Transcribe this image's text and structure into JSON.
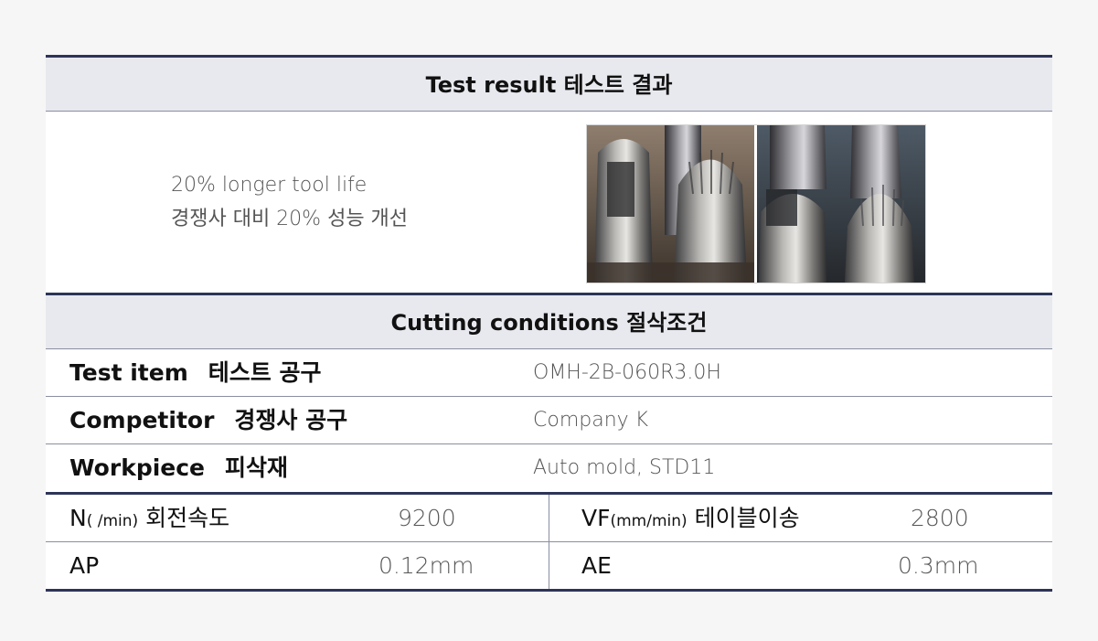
{
  "test_result": {
    "title": "Test result  테스트 결과",
    "line1": "20% longer tool life",
    "line2": "경쟁사 대비 20% 성능 개선",
    "photo_icon": "milling-tool-photo"
  },
  "cutting": {
    "title": "Cutting conditions  절삭조건",
    "rows": [
      {
        "label_en": "Test item",
        "label_kr": "테스트 공구",
        "value": "OMH-2B-060R3.0H"
      },
      {
        "label_en": "Competitor",
        "label_kr": "경쟁사 공구",
        "value": "Company K"
      },
      {
        "label_en": "Workpiece",
        "label_kr": "피삭재",
        "value": "Auto mold, STD11"
      }
    ]
  },
  "params": {
    "n": {
      "main": "N",
      "unit": "( /min)",
      "kr": " 회전속도",
      "value": "9200"
    },
    "vf": {
      "main": "VF",
      "unit": "(mm/min)",
      "kr": " 테이블이송",
      "value": "2800"
    },
    "ap": {
      "label": "AP",
      "value": "0.12mm"
    },
    "ae": {
      "label": "AE",
      "value": "0.3mm"
    }
  }
}
